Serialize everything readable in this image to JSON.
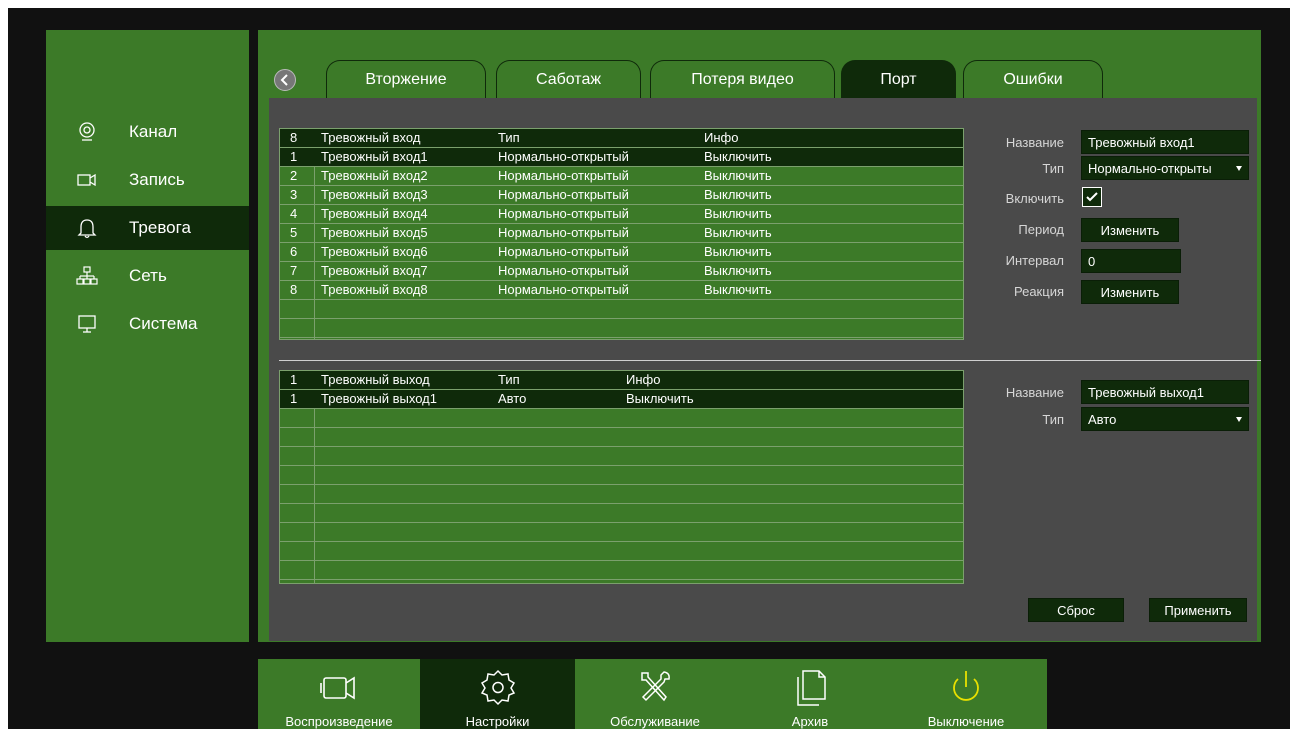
{
  "sidebar": {
    "items": [
      {
        "label": "Канал",
        "icon": "camera-lens-icon"
      },
      {
        "label": "Запись",
        "icon": "video-record-icon"
      },
      {
        "label": "Тревога",
        "icon": "bell-icon"
      },
      {
        "label": "Сеть",
        "icon": "network-icon"
      },
      {
        "label": "Система",
        "icon": "monitor-icon"
      }
    ],
    "active_index": 2
  },
  "tabs": [
    {
      "label": "Вторжение"
    },
    {
      "label": "Саботаж"
    },
    {
      "label": "Потеря видео"
    },
    {
      "label": "Порт"
    },
    {
      "label": "Ошибки"
    }
  ],
  "inputs_table": {
    "header": [
      "8",
      "Тревожный вход",
      "Тип",
      "Инфо"
    ],
    "rows": [
      [
        "1",
        "Тревожный вход1",
        "Нормально-открытый",
        "Выключить"
      ],
      [
        "2",
        "Тревожный вход2",
        "Нормально-открытый",
        "Выключить"
      ],
      [
        "3",
        "Тревожный вход3",
        "Нормально-открытый",
        "Выключить"
      ],
      [
        "4",
        "Тревожный вход4",
        "Нормально-открытый",
        "Выключить"
      ],
      [
        "5",
        "Тревожный вход5",
        "Нормально-открытый",
        "Выключить"
      ],
      [
        "6",
        "Тревожный вход6",
        "Нормально-открытый",
        "Выключить"
      ],
      [
        "7",
        "Тревожный вход7",
        "Нормально-открытый",
        "Выключить"
      ],
      [
        "8",
        "Тревожный вход8",
        "Нормально-открытый",
        "Выключить"
      ]
    ]
  },
  "outputs_table": {
    "header": [
      "1",
      "Тревожный выход",
      "Тип",
      "Инфо"
    ],
    "rows": [
      [
        "1",
        "Тревожный выход1",
        "Авто",
        "Выключить"
      ]
    ]
  },
  "input_props": {
    "name_label": "Название",
    "name_value": "Тревожный вход1",
    "type_label": "Тип",
    "type_value": "Нормально-открыты",
    "enable_label": "Включить",
    "enable_checked": true,
    "period_label": "Период",
    "period_button": "Изменить",
    "interval_label": "Интервал",
    "interval_value": "0",
    "reaction_label": "Реакция",
    "reaction_button": "Изменить"
  },
  "output_props": {
    "name_label": "Название",
    "name_value": "Тревожный выход1",
    "type_label": "Тип",
    "type_value": "Авто"
  },
  "actions": {
    "reset": "Сброс",
    "apply": "Применить"
  },
  "bottombar": {
    "items": [
      {
        "label": "Воспроизведение",
        "icon": "video-camera-icon"
      },
      {
        "label": "Настройки",
        "icon": "settings-gear-icon"
      },
      {
        "label": "Обслуживание",
        "icon": "tools-icon"
      },
      {
        "label": "Архив",
        "icon": "files-icon"
      },
      {
        "label": "Выключение",
        "icon": "power-icon"
      }
    ],
    "active_index": 1
  },
  "colors": {
    "panel_green": "#3c7a28",
    "dark_green": "#0f2a0a",
    "content_gray": "#4a4a4a",
    "power_yellow": "#e8e000"
  }
}
